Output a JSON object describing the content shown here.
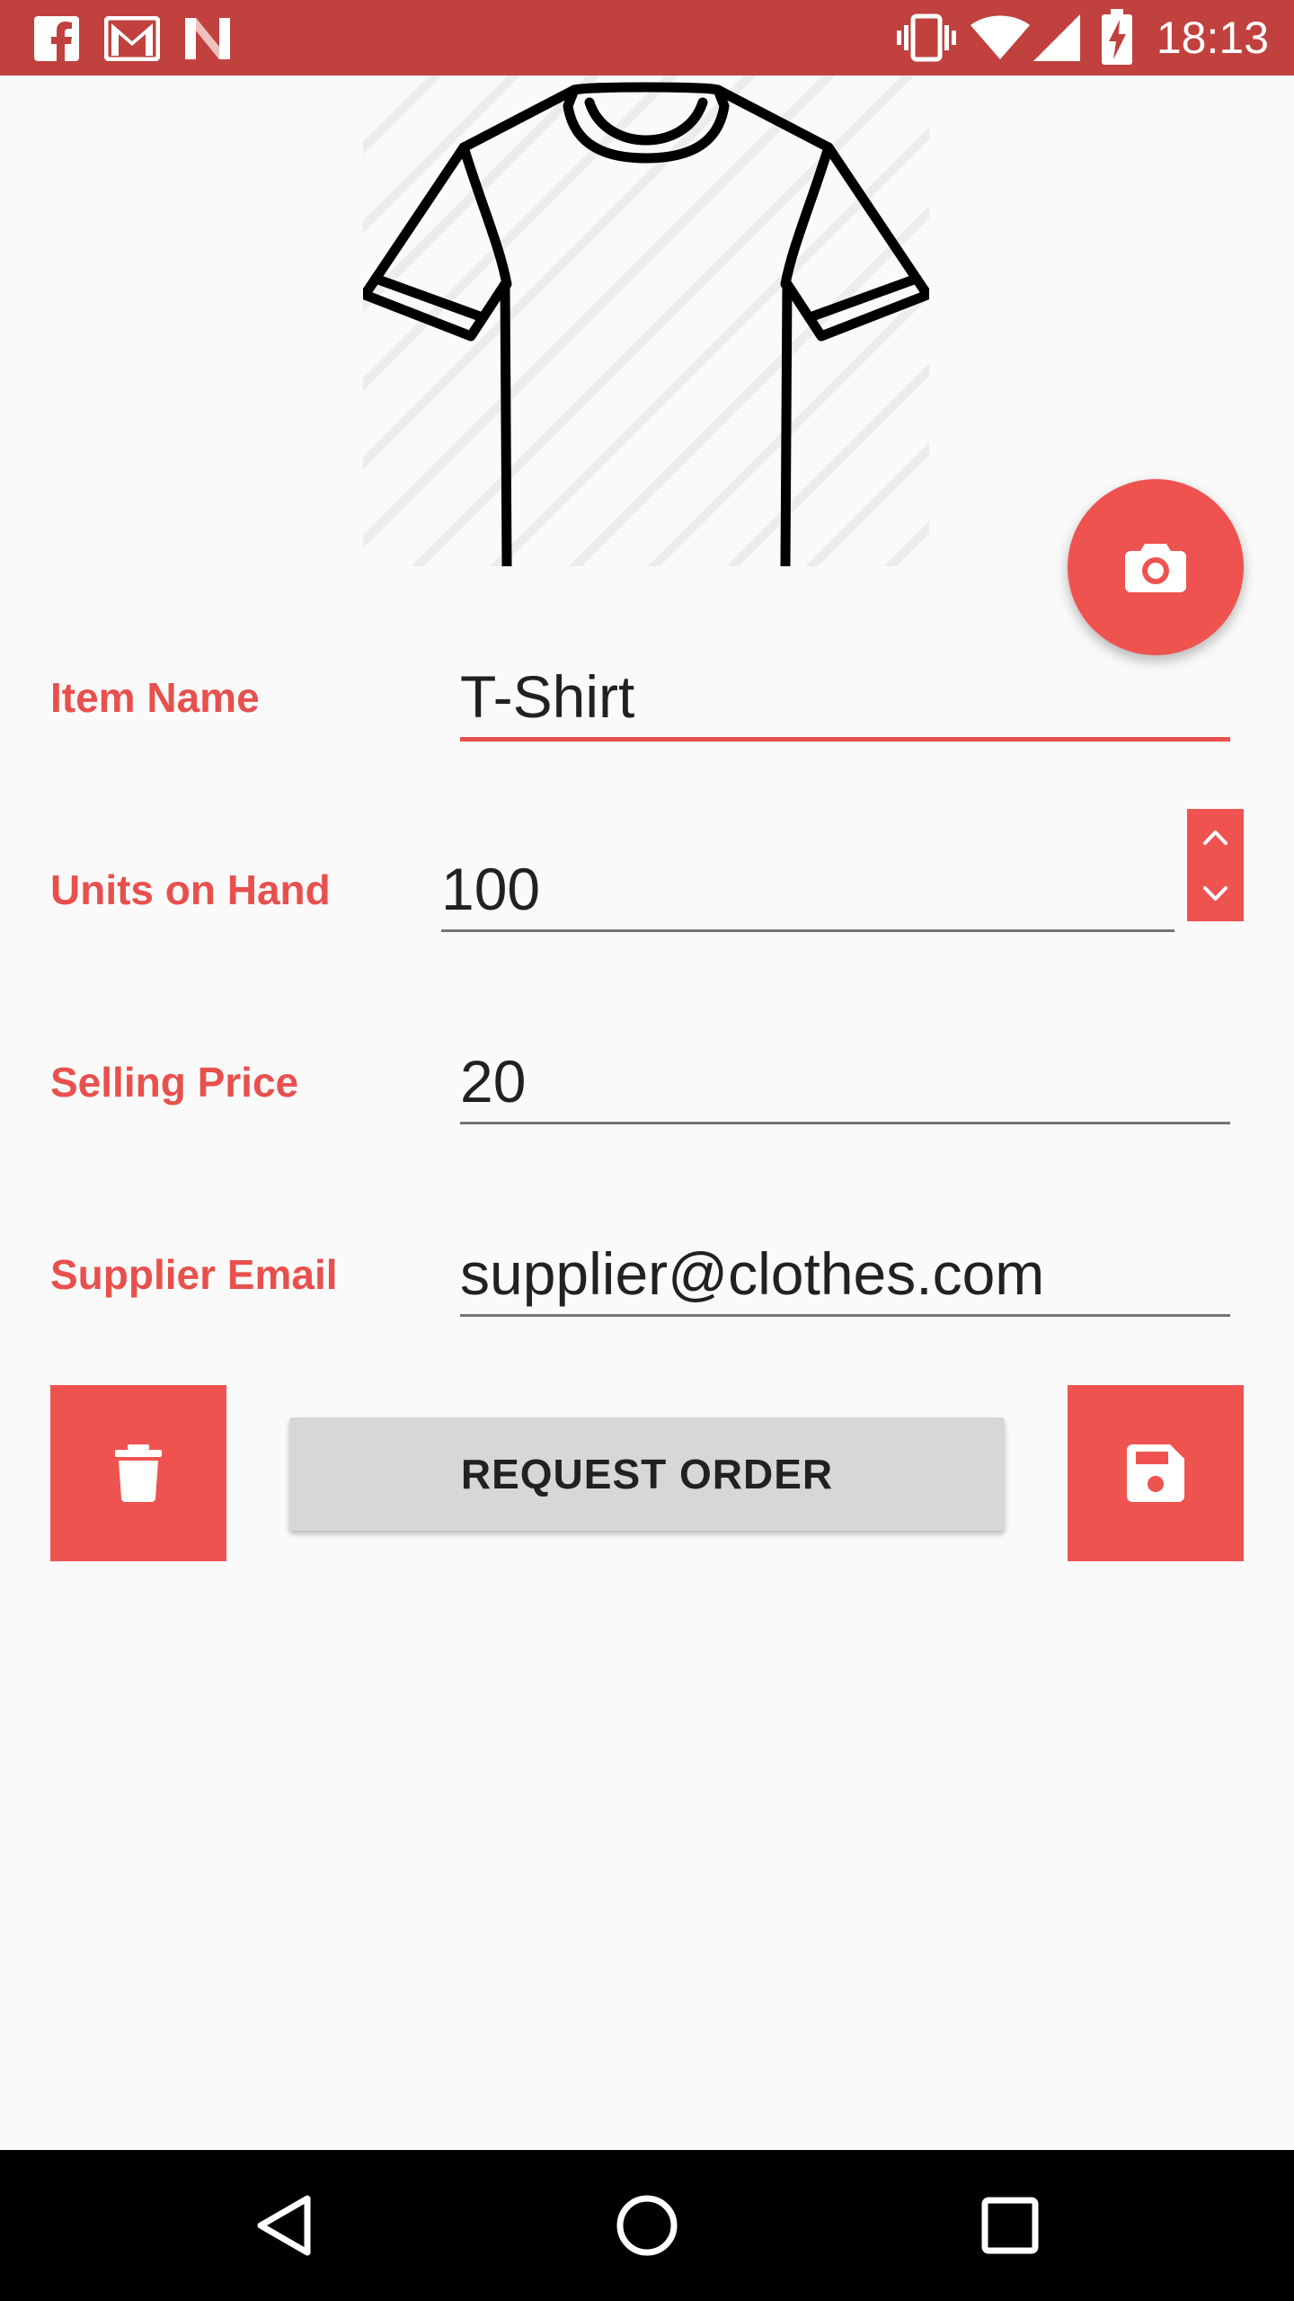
{
  "status_bar": {
    "time": "18:13",
    "notification_icons": [
      "facebook-icon",
      "gmail-icon",
      "n-app-icon"
    ],
    "system_icons": [
      "vibrate-icon",
      "wifi-icon",
      "signal-icon",
      "battery-charging-icon"
    ],
    "color": "#c0413e"
  },
  "product": {
    "image_icon": "t-shirt-image",
    "camera_button_icon": "camera-icon"
  },
  "form": {
    "item_name": {
      "label": "Item Name",
      "value": "T-Shirt"
    },
    "units_on_hand": {
      "label": "Units on Hand",
      "value": "100"
    },
    "selling_price": {
      "label": "Selling Price",
      "value": "20"
    },
    "supplier_email": {
      "label": "Supplier Email",
      "value": "supplier@clothes.com"
    }
  },
  "stepper": {
    "up_icon": "chevron-up-icon",
    "down_icon": "chevron-down-icon"
  },
  "actions": {
    "delete_icon": "trash-icon",
    "request_label": "REQUEST ORDER",
    "save_icon": "floppy-disk-icon"
  },
  "nav_bar": {
    "icons": [
      "back-triangle-icon",
      "home-circle-icon",
      "recents-square-icon"
    ]
  },
  "colors": {
    "accent": "#ef5350",
    "label": "#e8504d",
    "status_bar": "#c0413e",
    "button_gray": "#d6d7d7",
    "background": "#fafafa"
  }
}
